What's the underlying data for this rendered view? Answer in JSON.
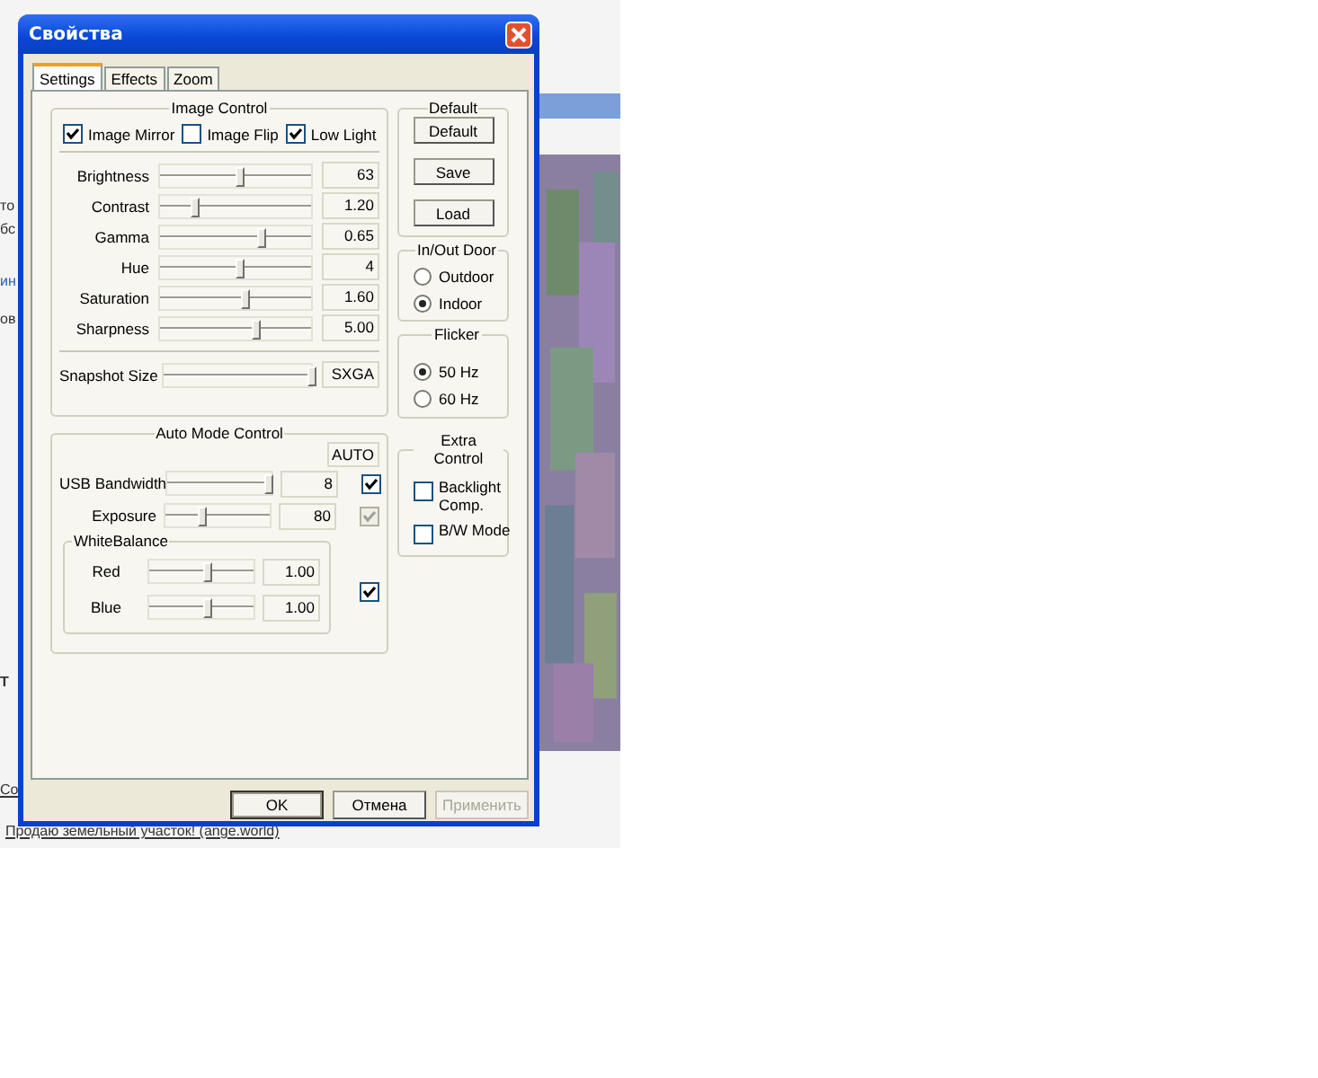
{
  "background_page": {
    "fragments": [
      "то",
      "бс",
      "ин",
      "ов",
      "Т",
      "Со"
    ],
    "link": "Продаю земельный участок! (ange.world)"
  },
  "window": {
    "title": "Свойства"
  },
  "tabs": [
    {
      "label": "Settings",
      "selected": true
    },
    {
      "label": "Effects",
      "selected": false
    },
    {
      "label": "Zoom",
      "selected": false
    }
  ],
  "image_control": {
    "title": "Image Control",
    "options": [
      {
        "label": "Image Mirror",
        "checked": true
      },
      {
        "label": "Image Flip",
        "checked": false
      },
      {
        "label": "Low Light",
        "checked": true
      }
    ],
    "sliders": [
      {
        "label": "Brightness",
        "level": 0.52,
        "value": "63"
      },
      {
        "label": "Contrast",
        "level": 0.23,
        "value": "1.20"
      },
      {
        "label": "Gamma",
        "level": 0.67,
        "value": "0.65"
      },
      {
        "label": "Hue",
        "level": 0.52,
        "value": "4"
      },
      {
        "label": "Saturation",
        "level": 0.56,
        "value": "1.60"
      },
      {
        "label": "Sharpness",
        "level": 0.63,
        "value": "5.00"
      }
    ],
    "snapshot": {
      "label": "Snapshot Size",
      "level": 1,
      "value": "SXGA"
    }
  },
  "default_group": {
    "title": "Default",
    "buttons": [
      "Default",
      "Save",
      "Load"
    ]
  },
  "in_out_door": {
    "title": "In/Out Door",
    "options": [
      {
        "label": "Outdoor",
        "selected": false
      },
      {
        "label": "Indoor",
        "selected": true
      }
    ]
  },
  "flicker": {
    "title": "Flicker",
    "options": [
      {
        "label": "50 Hz",
        "selected": true
      },
      {
        "label": "60 Hz",
        "selected": false
      }
    ]
  },
  "auto_mode": {
    "title": "Auto Mode Control",
    "auto_header": "AUTO",
    "rows": [
      {
        "label": "USB Bandwidth",
        "level": 0.96,
        "value": "8",
        "auto": true,
        "disabled": false
      },
      {
        "label": "Exposure",
        "level": 0.35,
        "value": "80",
        "auto": true,
        "disabled": true
      }
    ],
    "white_balance": {
      "title": "WhiteBalance",
      "auto": true,
      "rows": [
        {
          "label": "Red",
          "level": 0.55,
          "value": "1.00"
        },
        {
          "label": "Blue",
          "level": 0.55,
          "value": "1.00"
        }
      ]
    }
  },
  "extra_control": {
    "title": "Extra Control",
    "options": [
      {
        "label": "Backlight Comp.",
        "checked": false
      },
      {
        "label": "B/W Mode",
        "checked": false
      }
    ]
  },
  "buttons": [
    {
      "label": "OK",
      "disabled": false,
      "default": true
    },
    {
      "label": "Отмена",
      "disabled": false,
      "default": false
    },
    {
      "label": "Применить",
      "disabled": true,
      "default": false
    }
  ]
}
